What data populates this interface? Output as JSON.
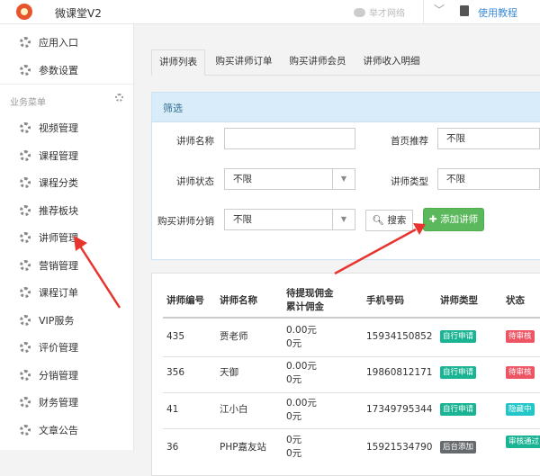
{
  "header": {
    "app_title": "微课堂V2",
    "wechat_label": "举才网络",
    "help_label": "使用教程"
  },
  "sidebar": {
    "top_items": [
      {
        "label": "应用入口"
      },
      {
        "label": "参数设置"
      }
    ],
    "group_label": "业务菜单",
    "items": [
      {
        "label": "视频管理"
      },
      {
        "label": "课程管理"
      },
      {
        "label": "课程分类"
      },
      {
        "label": "推荐板块"
      },
      {
        "label": "讲师管理"
      },
      {
        "label": "营销管理"
      },
      {
        "label": "课程订单"
      },
      {
        "label": "VIP服务"
      },
      {
        "label": "评价管理"
      },
      {
        "label": "分销管理"
      },
      {
        "label": "财务管理"
      },
      {
        "label": "文章公告"
      }
    ]
  },
  "tabs": [
    {
      "label": "讲师列表",
      "active": true
    },
    {
      "label": "购买讲师订单"
    },
    {
      "label": "购买讲师会员"
    },
    {
      "label": "讲师收入明细"
    }
  ],
  "filter": {
    "title": "筛选",
    "teacher_name_label": "讲师名称",
    "teacher_name_value": "",
    "homepage_recommend_label": "首页推荐",
    "homepage_recommend_value": "不限",
    "teacher_status_label": "讲师状态",
    "teacher_status_value": "不限",
    "teacher_type_label": "讲师类型",
    "teacher_type_value": "不限",
    "purchase_distribution_label": "购买讲师分销",
    "purchase_distribution_value": "不限",
    "search_button": "搜索",
    "add_button": "添加讲师"
  },
  "table": {
    "headers": [
      "讲师编号",
      "讲师名称",
      "待提现佣金",
      "累计佣金",
      "手机号码",
      "讲师类型",
      "状态"
    ],
    "rows": [
      {
        "id": "435",
        "name": "贾老师",
        "pending": "0.00元",
        "total": "0元",
        "phone": "15934150852",
        "type": "自行申请",
        "type_color": "#1ab394",
        "status": "待审核",
        "status_color": "#ed5565"
      },
      {
        "id": "356",
        "name": "天御",
        "pending": "0.00元",
        "total": "0元",
        "phone": "19860812171",
        "type": "自行申请",
        "type_color": "#1ab394",
        "status": "待审核",
        "status_color": "#ed5565"
      },
      {
        "id": "41",
        "name": "江小白",
        "pending": "0.00元",
        "total": "0元",
        "phone": "17349795344",
        "type": "自行申请",
        "type_color": "#1ab394",
        "status": "隐藏中",
        "status_color": "#23c6c8"
      },
      {
        "id": "36",
        "name": "PHP嘉友站",
        "pending": "0元",
        "total": "0元",
        "phone": "15921534790",
        "type": "后台添加",
        "type_color": "#676a6c",
        "status": "审核通过",
        "status_color": "#1ab394"
      }
    ]
  },
  "colors": {
    "accent_blue": "#3c8cd8",
    "add_button_green": "#5cb85c",
    "annotation_arrow": "#e8342f"
  }
}
